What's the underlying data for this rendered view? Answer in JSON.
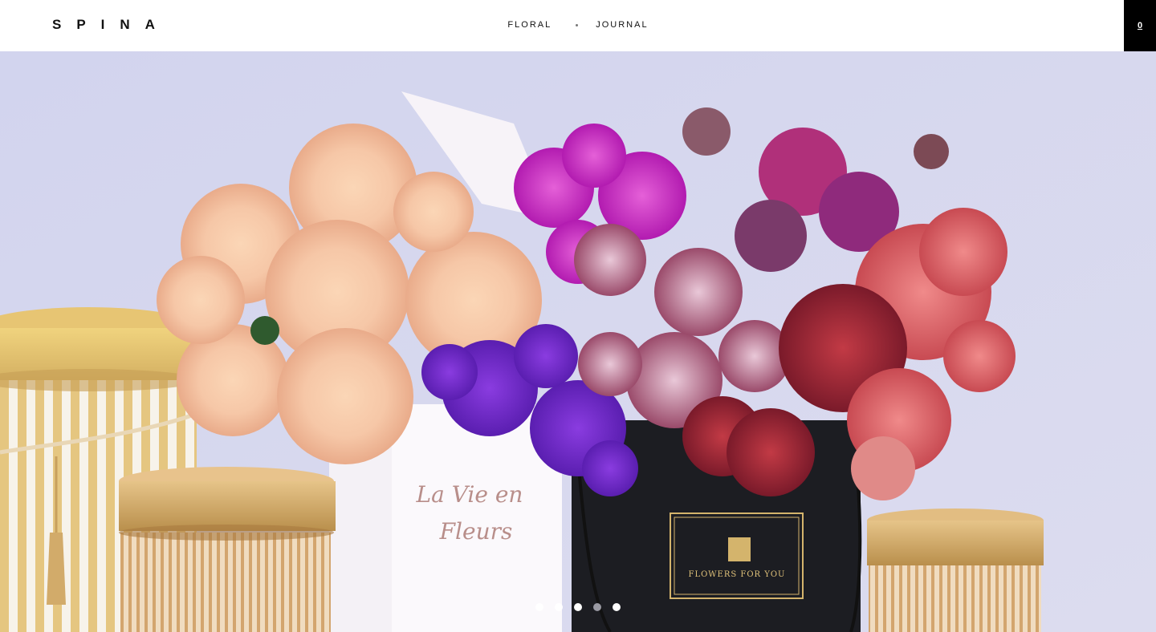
{
  "brand": {
    "logo": "SPINA"
  },
  "nav": {
    "items": [
      {
        "label": "FLORAL"
      },
      {
        "label": "JOURNAL"
      }
    ]
  },
  "cart": {
    "count": "0"
  },
  "hero": {
    "box_white_text_line1": "La Vie en",
    "box_white_text_line2": "Fleurs",
    "box_black_text": "FLOWERS FOR YOU",
    "slides": {
      "total": 5,
      "active_index": 3
    }
  },
  "colors": {
    "background": "#d6d7ee",
    "header": "#ffffff",
    "cart": "#000000",
    "gold": "#d8b36a",
    "dot_active": "#ffffff",
    "dot_inactive": "#9a9aa3"
  }
}
